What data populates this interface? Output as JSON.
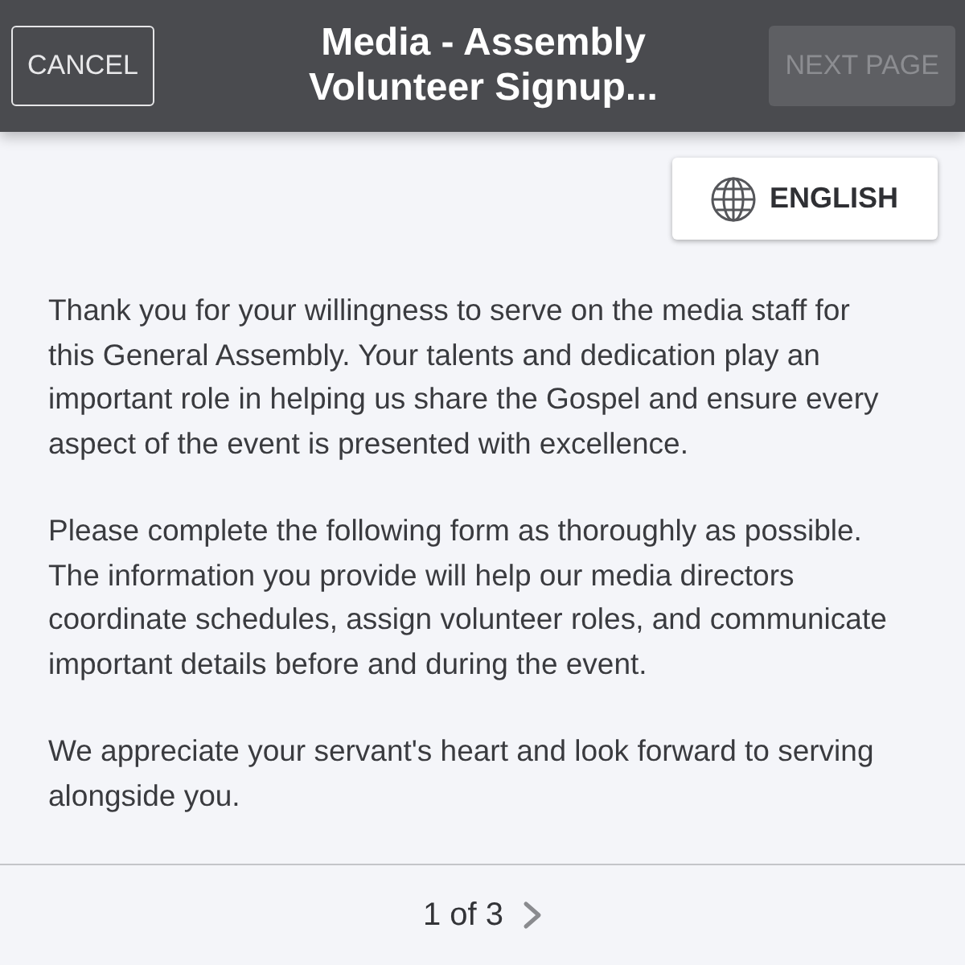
{
  "header": {
    "title": "Media - Assembly Volunteer Signup...",
    "buttons": [
      {
        "label": "CANCEL",
        "kind": "cancel",
        "disabled": false
      },
      {
        "label": "NEXT PAGE",
        "kind": "next",
        "disabled": true
      }
    ]
  },
  "language_button": {
    "label": "ENGLISH"
  },
  "paragraphs": [
    "Thank you for your willingness to serve on the media staff for this General Assembly. Your talents and dedication play an important role in helping us share the Gospel and ensure every aspect of the event is presented with excellence.",
    "Please complete the following form as thoroughly as possible. The information you provide will help our media directors coordinate schedules, assign volunteer roles, and communicate important details before and during the event.",
    "We appreciate your servant's heart and look forward to serving alongside you."
  ],
  "pager": {
    "text": "1 of 3"
  }
}
